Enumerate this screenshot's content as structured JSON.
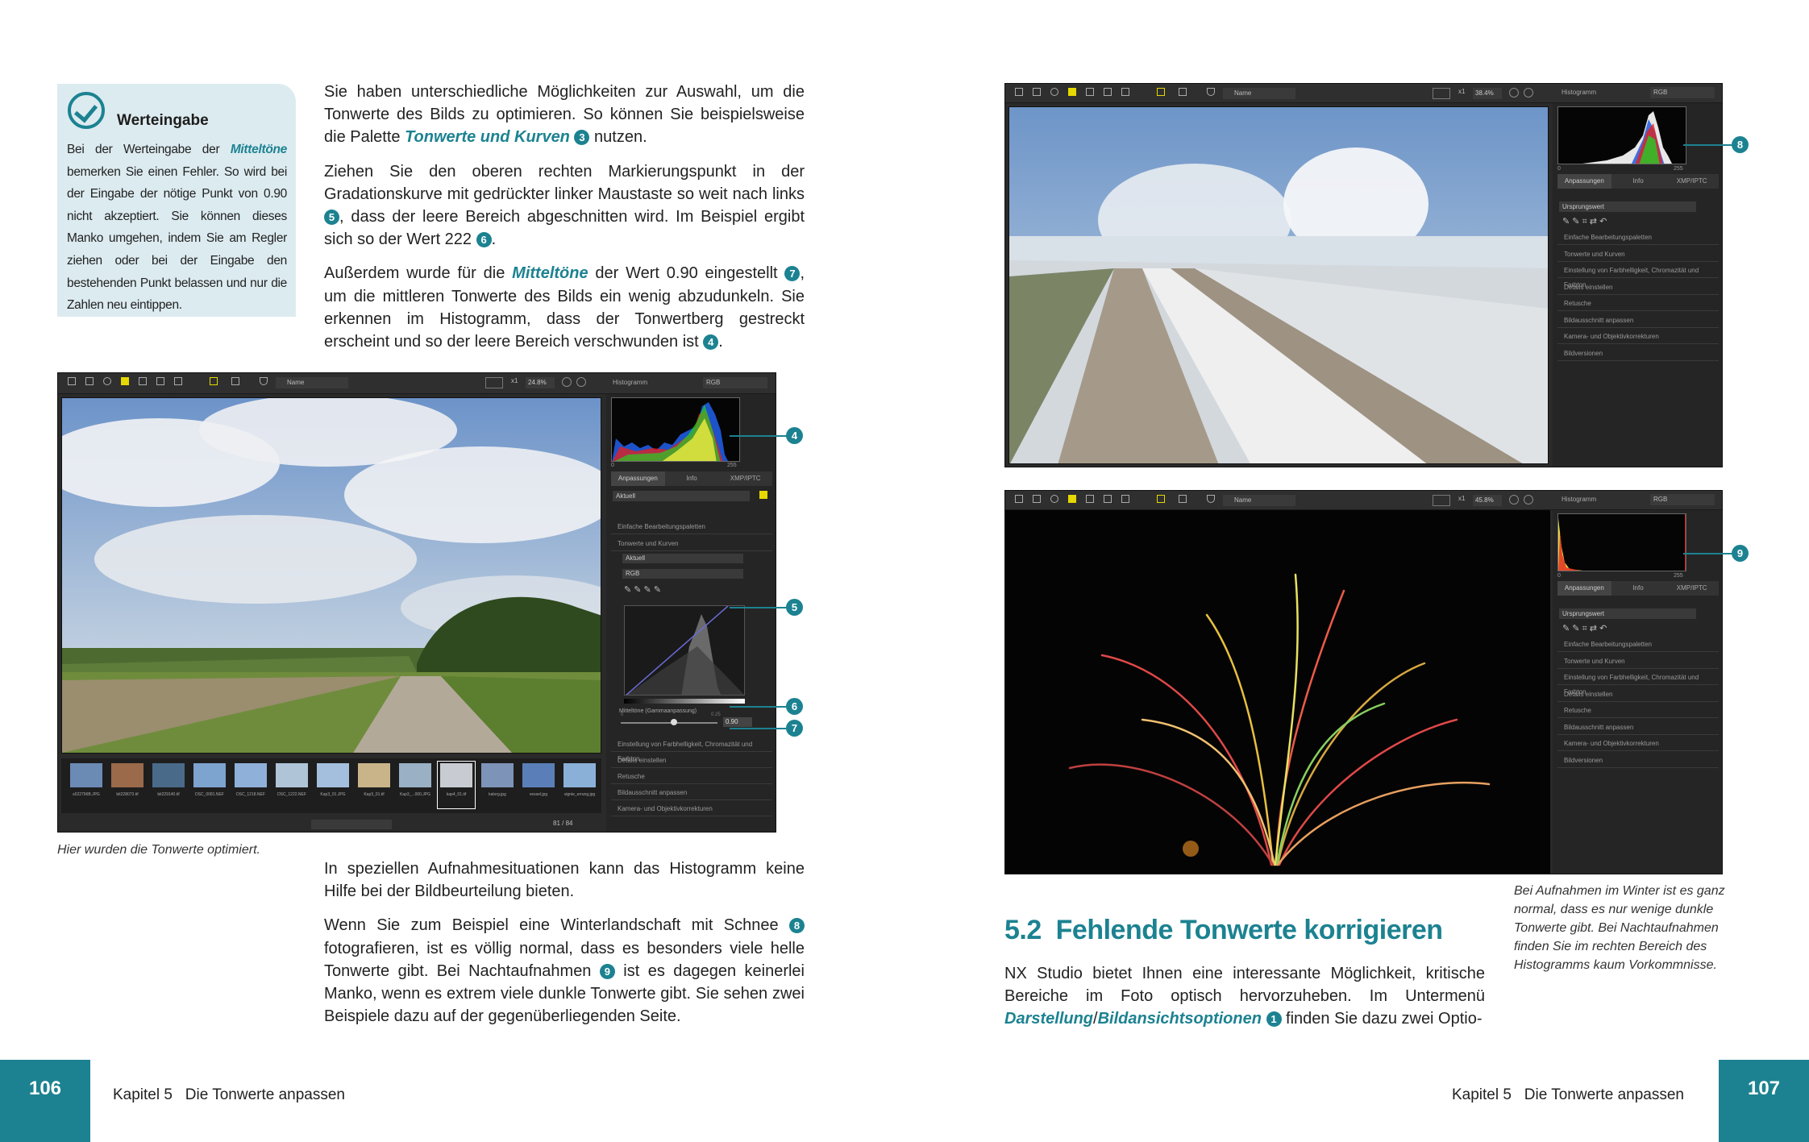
{
  "left_page": {
    "tip": {
      "title": "Werteingabe",
      "body_a": "Bei der Werteingabe der ",
      "body_em": "Mitteltöne",
      "body_b": " bemerken Sie einen Fehler. So wird bei der Eingabe der nötige Punkt von 0.90 nicht akzeptiert. Sie können dieses Manko umgehen, indem Sie am Regler ziehen oder bei der Eingabe den bestehenden Punkt belassen und nur die Zahlen neu eintippen."
    },
    "p1_a": "Sie haben unterschiedliche Möglichkeiten zur Auswahl, um die Tonwerte des Bilds zu optimieren. So können Sie beispielsweise die Palette ",
    "p1_em": "Tonwerte und Kurven",
    "p1_n": "3",
    "p1_b": " nutzen.",
    "p2_a": "Ziehen Sie den oberen rechten Markierungspunkt in der Gradationskurve mit gedrückter linker Maustaste so weit nach links ",
    "p2_n1": "5",
    "p2_b": ", dass der leere Bereich abgeschnitten wird. Im Beispiel ergibt sich so der Wert 222 ",
    "p2_n2": "6",
    "p2_c": ".",
    "p3_a": "Außerdem wurde für die ",
    "p3_em": "Mitteltöne",
    "p3_b": " der Wert 0.90 eingestellt ",
    "p3_n1": "7",
    "p3_c": ", um die mittleren Tonwerte des Bilds ein wenig abzudunkeln. Sie erkennen im Histogramm, dass der Tonwertberg gestreckt erscheint und so der leere Bereich verschwunden ist ",
    "p3_n2": "4",
    "p3_d": ".",
    "caption": "Hier wurden die Tonwerte optimiert.",
    "p4": "In speziellen Aufnahmesituationen kann das Histogramm keine Hilfe bei der Bildbeurteilung bieten.",
    "p5_a": "Wenn Sie zum Beispiel eine Winterlandschaft mit Schnee ",
    "p5_n1": "8",
    "p5_b": " fotografieren, ist es völlig normal, dass es besonders viele helle Tonwerte gibt. Bei Nachtaufnahmen ",
    "p5_n2": "9",
    "p5_c": " ist es dagegen keinerlei Manko, wenn es extrem viele dunkle Tonwerte gibt. Sie sehen zwei Beispiele dazu auf der gegenüberliegenden Seite.",
    "page_number": "106",
    "footer": "Kapitel 5   Die Tonwerte anpassen",
    "app": {
      "sort": "Name",
      "zoom_x": "x1",
      "zoom": "24.8%",
      "hist_label": "Histogramm",
      "hist_mode": "RGB",
      "hist_min": "0",
      "hist_max": "255",
      "tabs": [
        "Anpassungen",
        "Info",
        "XMP/IPTC"
      ],
      "preset": "Aktuell",
      "rows_top": [
        "Einfache Bearbeitungspaletten",
        "Tonwerte und Kurven"
      ],
      "curve_preset": "Aktuell",
      "curve_channel": "RGB",
      "midtones_label": "Mitteltöne (Gammaanpassung)",
      "midtones_value": "0.90",
      "midtones_min": "0",
      "midtones_max": "0.25",
      "rows_bottom": [
        "Einstellung von Farbhelligkeit, Chromazität und Farbton",
        "Details einstellen",
        "Retusche",
        "Bildausschnitt anpassen",
        "Kamera- und Objektivkorrekturen"
      ],
      "thumbs": [
        "s022796B.JPG",
        "bit228073.tif",
        "bit229140.tif",
        "DSC_0081.NEF",
        "DSC_1218.NEF",
        "DSC_1222.NEF",
        "Kap3_01.JPG",
        "Kap3_01.tif",
        "Kap3_...000.JPG",
        "kap4_01.tif",
        "kalorg.jpg",
        "vessel.jpg",
        "vignie_errung.jpg"
      ],
      "page_count": "81 / 84"
    },
    "callouts": [
      "4",
      "5",
      "6",
      "7"
    ]
  },
  "right_page": {
    "app_winter": {
      "sort": "Name",
      "zoom_x": "x1",
      "zoom": "38.4%",
      "hist_label": "Histogramm",
      "hist_mode": "RGB",
      "hist_min": "0",
      "hist_max": "255",
      "tabs": [
        "Anpassungen",
        "Info",
        "XMP/IPTC"
      ],
      "preset": "Ursprungswert",
      "rows": [
        "Einfache Bearbeitungspaletten",
        "Tonwerte und Kurven",
        "Einstellung von Farbhelligkeit, Chromazität und Farbton",
        "Details einstellen",
        "Retusche",
        "Bildausschnitt anpassen",
        "Kamera- und Objektivkorrekturen",
        "Bildversionen"
      ]
    },
    "app_night": {
      "sort": "Name",
      "zoom_x": "x1",
      "zoom": "45.8%",
      "hist_label": "Histogramm",
      "hist_mode": "RGB",
      "hist_min": "0",
      "hist_max": "255",
      "tabs": [
        "Anpassungen",
        "Info",
        "XMP/IPTC"
      ],
      "preset": "Ursprungswert",
      "rows": [
        "Einfache Bearbeitungspaletten",
        "Tonwerte und Kurven",
        "Einstellung von Farbhelligkeit, Chromazität und Farbton",
        "Details einstellen",
        "Retusche",
        "Bildausschnitt anpassen",
        "Kamera- und Objektivkorrekturen",
        "Bildversionen"
      ]
    },
    "callouts": [
      "8",
      "9"
    ],
    "caption": "Bei Aufnahmen im Winter ist es ganz normal, dass es nur wenige dunkle Tonwerte gibt. Bei Nachtaufnahmen finden Sie im rechten Bereich des Histogramms kaum Vorkommnisse.",
    "heading": "5.2  Fehlende Tonwerte korrigieren",
    "p1_a": "NX Studio bietet Ihnen eine interessante Möglichkeit, kritische Bereiche im Foto optisch hervorzuheben. Im Untermenü ",
    "p1_em1": "Darstellung",
    "p1_slash": "/",
    "p1_em2": "Bildansichtsoptionen",
    "p1_n": "1",
    "p1_b": " finden Sie dazu zwei Optio-",
    "page_number": "107",
    "footer": "Kapitel 5   Die Tonwerte anpassen"
  },
  "colors": {
    "accent": "#1c8291",
    "tip_bg": "#dcebf0",
    "app_bg": "#2a2a2a"
  }
}
